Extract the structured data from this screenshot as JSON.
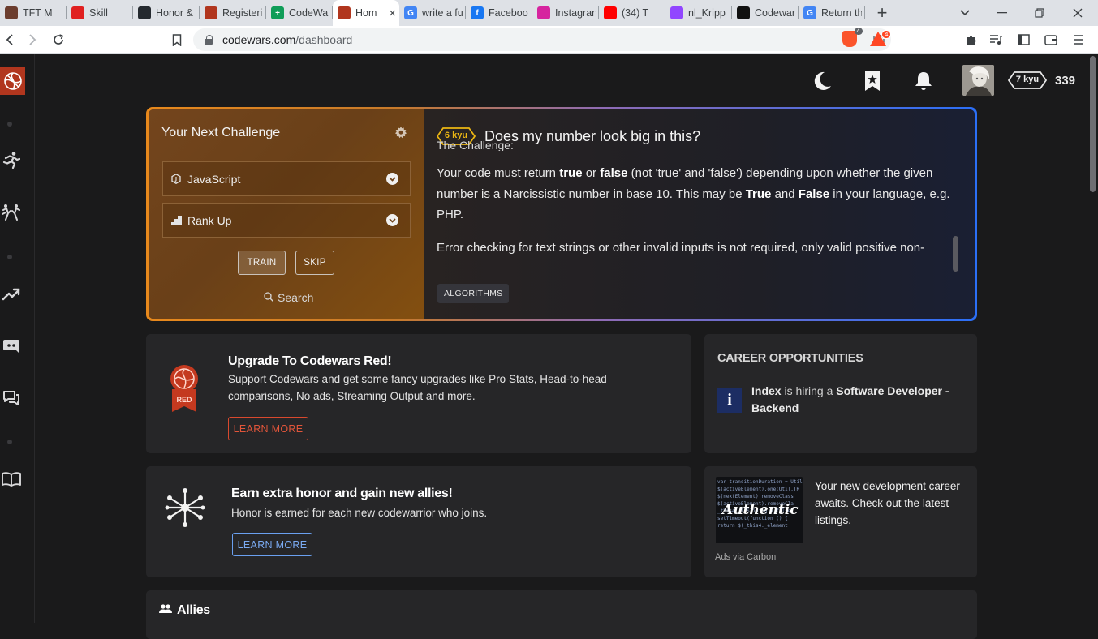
{
  "browser": {
    "tabs": [
      {
        "label": "TFT M",
        "color": "#6b3d2e",
        "glyph": "",
        "active": false
      },
      {
        "label": "Skill",
        "color": "#e02020",
        "glyph": "",
        "active": false
      },
      {
        "label": "Honor &",
        "color": "#24292f",
        "glyph": "",
        "active": false
      },
      {
        "label": "Registeri",
        "color": "#b1361e",
        "glyph": "",
        "active": false
      },
      {
        "label": "CodeWa",
        "color": "#0f9d58",
        "glyph": "+",
        "active": false
      },
      {
        "label": "Hom",
        "color": "#b1361e",
        "glyph": "",
        "active": true
      },
      {
        "label": "write a fu",
        "color": "#4285f4",
        "glyph": "G",
        "active": false
      },
      {
        "label": "Faceboo",
        "color": "#1877f2",
        "glyph": "f",
        "active": false
      },
      {
        "label": "Instagran",
        "color": "#d6249f",
        "glyph": "",
        "active": false
      },
      {
        "label": "(34) T",
        "color": "#ff0000",
        "glyph": "",
        "active": false
      },
      {
        "label": "nl_Kripp",
        "color": "#9146ff",
        "glyph": "",
        "active": false
      },
      {
        "label": "Codewar",
        "color": "#111111",
        "glyph": "",
        "active": false
      },
      {
        "label": "Return th",
        "color": "#4285f4",
        "glyph": "G",
        "active": false
      }
    ],
    "url_host": "codewars.com",
    "url_path": "/dashboard",
    "brave_count": "4",
    "bat_count": "4"
  },
  "header": {
    "rank": "7 kyu",
    "honor": "339"
  },
  "challenge": {
    "title": "Your Next Challenge",
    "language": "JavaScript",
    "strategy": "Rank Up",
    "train_label": "TRAIN",
    "skip_label": "SKIP",
    "search_label": "Search",
    "kyu": "6 kyu",
    "name": "Does my number look big in this?",
    "heading_cut": "The Challenge:",
    "p1_a": "Your code must return ",
    "p1_b": "true",
    "p1_c": " or ",
    "p1_d": "false",
    "p1_e": " (not 'true' and 'false') depending upon whether the given number is a Narcissistic number in base 10. This may be ",
    "p1_f": "True",
    "p1_g": " and ",
    "p1_h": "False",
    "p1_i": " in your language, e.g. PHP.",
    "p2": "Error checking for text strings or other invalid inputs is not required, only valid positive non-",
    "tag": "ALGORITHMS"
  },
  "upgrade": {
    "title": "Upgrade To Codewars Red!",
    "text": "Support Codewars and get some fancy upgrades like Pro Stats, Head-to-head comparisons, No ads, Streaming Output and more.",
    "button": "LEARN MORE",
    "badge": "RED"
  },
  "career": {
    "heading": "CAREER OPPORTUNITIES",
    "company": "Index",
    "middle": " is hiring a ",
    "role": "Software Developer - Backend",
    "logo_letter": "i"
  },
  "honor_card": {
    "title": "Earn extra honor and gain new allies!",
    "text": "Honor is earned for each new codewarrior who joins.",
    "button": "LEARN MORE"
  },
  "ad": {
    "text": "Your new development career awaits. Check out the latest listings.",
    "via": "Ads via Carbon",
    "image_word": "Authentic"
  },
  "allies": {
    "title": "Allies"
  },
  "colors": {
    "brand_red": "#b1361e",
    "learn_red": "#d9492e",
    "learn_blue": "#6aa0f0",
    "border_start": "#e8891c",
    "border_end": "#2b6ff7",
    "kyu_yellow": "#ecb613"
  }
}
